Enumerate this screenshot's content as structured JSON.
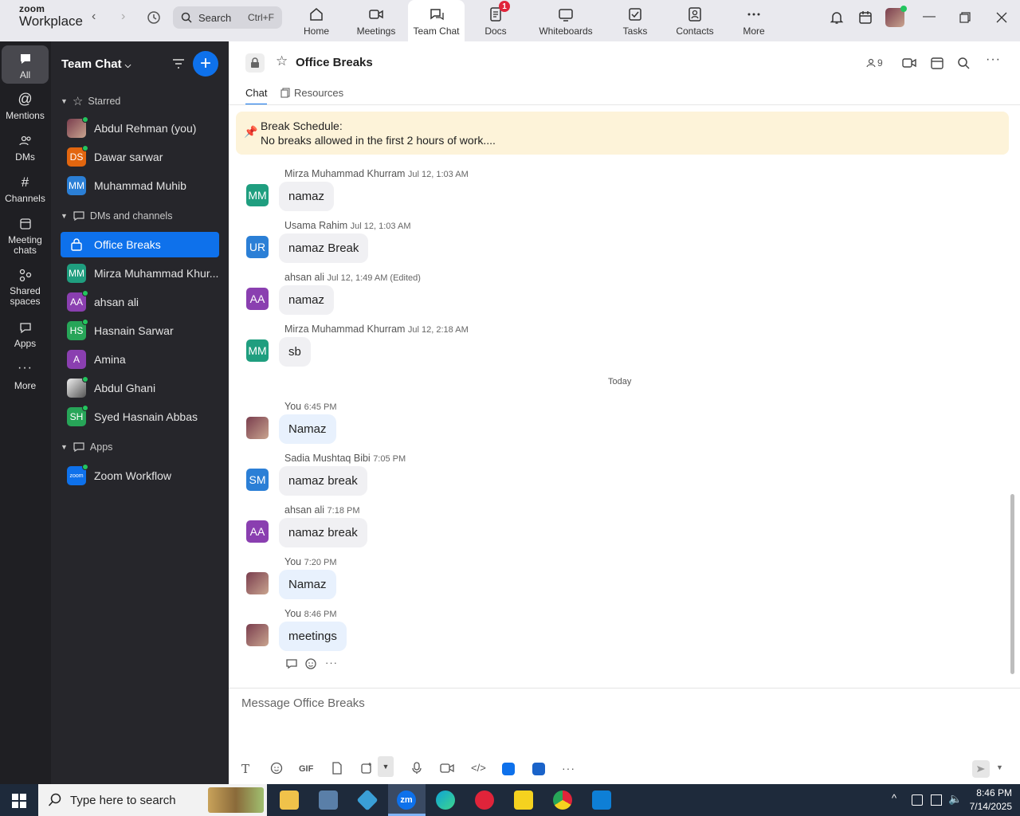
{
  "brand": {
    "line1": "zoom",
    "line2": "Workplace"
  },
  "search": {
    "label": "Search",
    "shortcut": "Ctrl+F"
  },
  "nav": [
    {
      "label": "Home"
    },
    {
      "label": "Meetings"
    },
    {
      "label": "Team Chat"
    },
    {
      "label": "Docs",
      "badge": "1"
    },
    {
      "label": "Whiteboards"
    },
    {
      "label": "Tasks"
    },
    {
      "label": "Contacts"
    },
    {
      "label": "More"
    }
  ],
  "rail": [
    {
      "label": "All"
    },
    {
      "label": "Mentions"
    },
    {
      "label": "DMs"
    },
    {
      "label": "Channels"
    },
    {
      "label": "Meeting chats"
    },
    {
      "label": "Shared spaces"
    },
    {
      "label": "Apps"
    },
    {
      "label": "More"
    }
  ],
  "sidebar": {
    "title": "Team Chat",
    "starred_label": "Starred",
    "starred": [
      {
        "name": "Abdul Rehman (you)",
        "initials": "",
        "color": "#7a3e4e"
      },
      {
        "name": "Dawar sarwar",
        "initials": "DS",
        "color": "#e2660f"
      },
      {
        "name": "Muhammad Muhib",
        "initials": "MM",
        "color": "#2b7fd6"
      }
    ],
    "dms_label": "DMs and channels",
    "dms": [
      {
        "name": "Office Breaks",
        "initials": "",
        "color": ""
      },
      {
        "name": "Mirza Muhammad Khur...",
        "initials": "MM",
        "color": "#1f9e7f"
      },
      {
        "name": "ahsan ali",
        "initials": "AA",
        "color": "#8a3fb0"
      },
      {
        "name": "Hasnain Sarwar",
        "initials": "HS",
        "color": "#27a558"
      },
      {
        "name": "Amina",
        "initials": "A",
        "color": "#8a3fb0"
      },
      {
        "name": "Abdul Ghani",
        "initials": "",
        "color": "#555555"
      },
      {
        "name": "Syed Hasnain Abbas",
        "initials": "SH",
        "color": "#27a558"
      }
    ],
    "apps_label": "Apps",
    "apps": [
      {
        "name": "Zoom Workflow",
        "initials": "zoom",
        "color": "#0e71eb"
      }
    ]
  },
  "channel": {
    "title": "Office Breaks",
    "member_count": "9",
    "tabs": [
      "Chat",
      "Resources"
    ],
    "pinned_line1": "Break Schedule:",
    "pinned_line2": "No breaks allowed in the first 2 hours of work...."
  },
  "messages": [
    {
      "sender": "Mirza Muhammad Khurram",
      "time": "Jul 12, 1:03 AM",
      "text": "namaz",
      "initials": "MM",
      "color": "#1f9e7f"
    },
    {
      "sender": "Usama Rahim",
      "time": "Jul 12, 1:03 AM",
      "text": "namaz Break",
      "initials": "UR",
      "color": "#2b7fd6"
    },
    {
      "sender": "ahsan ali",
      "time": "Jul 12, 1:49 AM (Edited)",
      "text": "namaz",
      "initials": "AA",
      "color": "#8a3fb0"
    },
    {
      "sender": "Mirza Muhammad Khurram",
      "time": "Jul 12, 2:18 AM",
      "text": "sb",
      "initials": "MM",
      "color": "#1f9e7f"
    },
    {
      "sender": "You",
      "time": "6:45 PM",
      "text": "Namaz",
      "initials": "",
      "color": "#7a3e4e"
    },
    {
      "sender": "Sadia Mushtaq Bibi",
      "time": "7:05 PM",
      "text": "namaz break",
      "initials": "SM",
      "color": "#2b7fd6"
    },
    {
      "sender": "ahsan ali",
      "time": "7:18 PM",
      "text": "namaz break",
      "initials": "AA",
      "color": "#8a3fb0"
    },
    {
      "sender": "You",
      "time": "7:20 PM",
      "text": "Namaz",
      "initials": "",
      "color": "#7a3e4e"
    },
    {
      "sender": "You",
      "time": "8:46 PM",
      "text": "meetings",
      "initials": "",
      "color": "#7a3e4e"
    }
  ],
  "divider_today": "Today",
  "compose_placeholder": "Message Office Breaks",
  "taskbar": {
    "search_placeholder": "Type here to search",
    "time": "8:46 PM",
    "date": "7/14/2025"
  },
  "colors": {
    "accent": "#0e71eb",
    "rail_bg": "#1f1f23",
    "sidebar_bg": "#26262b",
    "pinned_bg": "#fdf3d9"
  }
}
